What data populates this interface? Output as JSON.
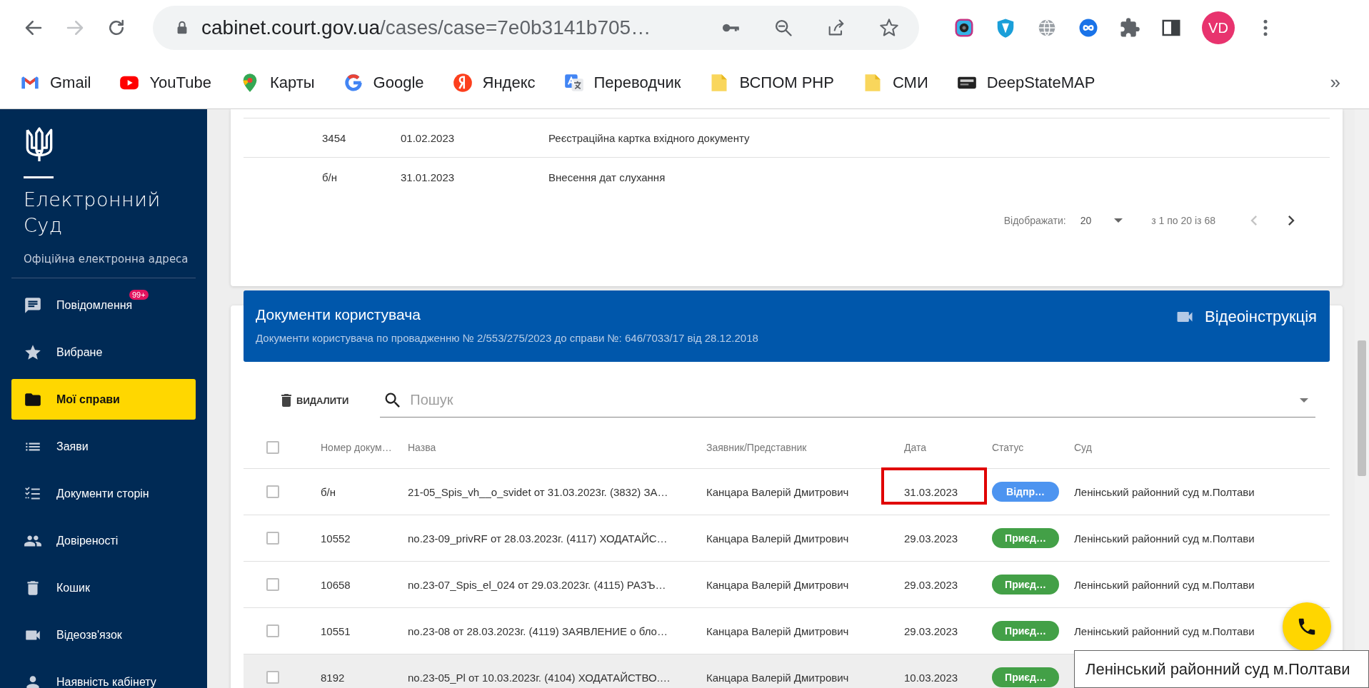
{
  "browser": {
    "url_domain": "cabinet.court.gov.ua",
    "url_path": "/cases/case=7e0b3141b705…",
    "avatar": "VD",
    "bookmarks": [
      {
        "label": "Gmail"
      },
      {
        "label": "YouTube"
      },
      {
        "label": "Карты"
      },
      {
        "label": "Google"
      },
      {
        "label": "Яндекс"
      },
      {
        "label": "Переводчик"
      },
      {
        "label": "ВСПОМ PHP"
      },
      {
        "label": "СМИ"
      },
      {
        "label": "DeepStateMAP"
      }
    ],
    "more": "»"
  },
  "sidebar": {
    "title": "Електронний Суд",
    "subtitle": "Офіційна електронна адреса",
    "items": [
      {
        "label": "Повідомлення",
        "badge": "99+",
        "selected": false
      },
      {
        "label": "Вибране",
        "selected": false
      },
      {
        "label": "Мої справи",
        "selected": true
      },
      {
        "label": "Заяви",
        "selected": false
      },
      {
        "label": "Документи сторін",
        "selected": false
      },
      {
        "label": "Довіреності",
        "selected": false
      },
      {
        "label": "Кошик",
        "selected": false
      },
      {
        "label": "Відеозв'язок",
        "selected": false
      },
      {
        "label": "Наявність кабінету",
        "selected": false
      }
    ]
  },
  "history": {
    "rows": [
      {
        "number": "3454",
        "date": "01.02.2023",
        "title": "Реєстраційна картка вхідного документу"
      },
      {
        "number": "б/н",
        "date": "31.01.2023",
        "title": "Внесення дат слухання"
      }
    ],
    "pagination": {
      "label": "Відображати:",
      "per_page": "20",
      "range": "з 1 по 20 із 68"
    }
  },
  "documents": {
    "title": "Документи користувача",
    "subtitle": "Документи користувача по провадженню № 2/553/275/2023 до справи №: 646/7033/17 від 28.12.2018",
    "video_link": "Відеоінструкція",
    "delete": "ВИДАЛИТИ",
    "search": {
      "placeholder": "Пошук"
    },
    "all_checked": false,
    "columns": [
      "Номер докум…",
      "Назва",
      "Заявник/Представник",
      "Дата",
      "Статус",
      "Суд"
    ],
    "rows": [
      {
        "checked": false,
        "hovered": false,
        "highlighted": true,
        "number": "б/н",
        "name": "21-05_Spis_vh__o_svidet от 31.03.2023г. (3832) ЗА…",
        "applicant": "Канцара Валерій Дмитрович",
        "date": "31.03.2023",
        "status": {
          "label": "Відпр…",
          "color": "#4d94f0"
        },
        "court": "Ленінський районний суд м.Полтави"
      },
      {
        "checked": false,
        "hovered": false,
        "highlighted": false,
        "number": "10552",
        "name": "no.23-09_privRF от 28.03.2023г. (4117) ХОДАТАЙС…",
        "applicant": "Канцара Валерій Дмитрович",
        "date": "29.03.2023",
        "status": {
          "label": "Приєд…",
          "color": "#43a047"
        },
        "court": "Ленінський районний суд м.Полтави"
      },
      {
        "checked": false,
        "hovered": false,
        "highlighted": false,
        "number": "10658",
        "name": "no.23-07_Spis_el_024 от 29.03.2023г. (4115) РАЗЪ…",
        "applicant": "Канцара Валерій Дмитрович",
        "date": "29.03.2023",
        "status": {
          "label": "Приєд…",
          "color": "#43a047"
        },
        "court": "Ленінський районний суд м.Полтави"
      },
      {
        "checked": false,
        "hovered": false,
        "highlighted": false,
        "number": "10551",
        "name": "no.23-08 от 28.03.2023г. (4119) ЗАЯВЛЕНИЕ о бло…",
        "applicant": "Канцара Валерій Дмитрович",
        "date": "29.03.2023",
        "status": {
          "label": "Приєд…",
          "color": "#43a047"
        },
        "court": "Ленінський районний суд м.Полтави"
      },
      {
        "checked": false,
        "hovered": true,
        "highlighted": false,
        "number": "8192",
        "name": "no.23-05_Pl от 10.03.2023г. (4104) ХОДАТАЙСТВО.…",
        "applicant": "Канцара Валерій Дмитрович",
        "date": "10.03.2023",
        "status": {
          "label": "Приєд…",
          "color": "#43a047"
        }
      }
    ]
  },
  "tooltip": "Ленінський районний суд м.Полтави"
}
